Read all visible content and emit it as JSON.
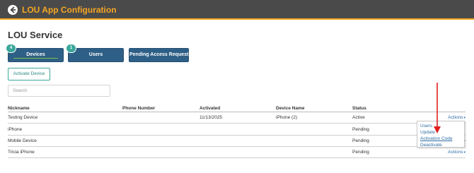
{
  "header": {
    "title": "LOU App Configuration",
    "back_icon": "back-arrow-icon"
  },
  "page": {
    "title": "LOU Service"
  },
  "tabs": [
    {
      "label": "Devices",
      "badge": "4",
      "active": true
    },
    {
      "label": "Users",
      "badge": "1",
      "active": false
    },
    {
      "label": "Pending Access Requests",
      "badge": "",
      "active": false
    }
  ],
  "toolbar": {
    "activate_label": "Activate Device"
  },
  "search": {
    "placeholder": "Search",
    "value": ""
  },
  "table": {
    "columns": [
      "Nickname",
      "Phone Number",
      "Activated",
      "Device Name",
      "Status"
    ],
    "actions_label": "Actions",
    "rows": [
      {
        "nickname": "Testing Device",
        "phone": "",
        "activated": "11/13/2025",
        "device_name": "iPhone (2)",
        "status": "Active"
      },
      {
        "nickname": "iPhone",
        "phone": "",
        "activated": "",
        "device_name": "",
        "status": "Pending"
      },
      {
        "nickname": "Mobile Device",
        "phone": "",
        "activated": "",
        "device_name": "",
        "status": "Pending"
      },
      {
        "nickname": "Tricia iPhone",
        "phone": "",
        "activated": "",
        "device_name": "",
        "status": "Pending"
      }
    ]
  },
  "actions_menu": {
    "items": [
      "Users",
      "Update",
      "Activation Code",
      "Deactivate"
    ]
  },
  "colors": {
    "header_bg": "#4a4a4a",
    "header_accent": "#f5a623",
    "tab_bg": "#2e5f86",
    "badge": "#3aa79a",
    "link": "#2e6da4",
    "annotation_arrow": "#e02020"
  }
}
